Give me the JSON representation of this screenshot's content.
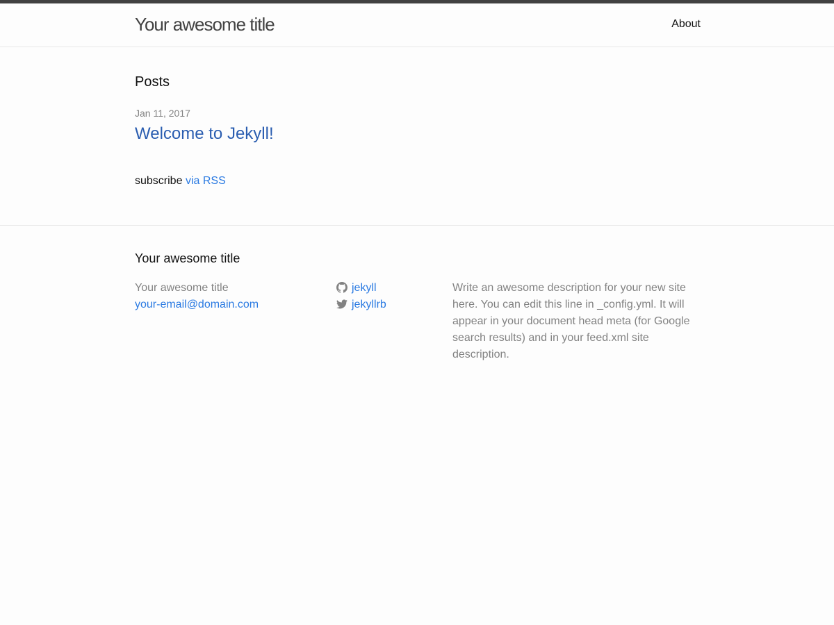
{
  "header": {
    "site_title": "Your awesome title",
    "nav": {
      "about_label": "About"
    }
  },
  "main": {
    "heading": "Posts",
    "posts": [
      {
        "date": "Jan 11, 2017",
        "title": "Welcome to Jekyll!"
      }
    ],
    "rss": {
      "prefix": "subscribe",
      "link_label": "via RSS"
    }
  },
  "footer": {
    "heading": "Your awesome title",
    "contact": {
      "name": "Your awesome title",
      "email": "your-email@domain.com"
    },
    "social": [
      {
        "icon": "github-icon",
        "label": "jekyll"
      },
      {
        "icon": "twitter-icon",
        "label": "jekyllrb"
      }
    ],
    "description": "Write an awesome description for your new site here. You can edit this line in _config.yml. It will appear in your document head meta (for Google search results) and in your feed.xml site description."
  },
  "colors": {
    "header_border_top": "#424242",
    "title_text": "#424242",
    "post_link": "#2a5db0",
    "link": "#2a7ae2",
    "muted_text": "#828282",
    "background": "#fdfdfd"
  }
}
